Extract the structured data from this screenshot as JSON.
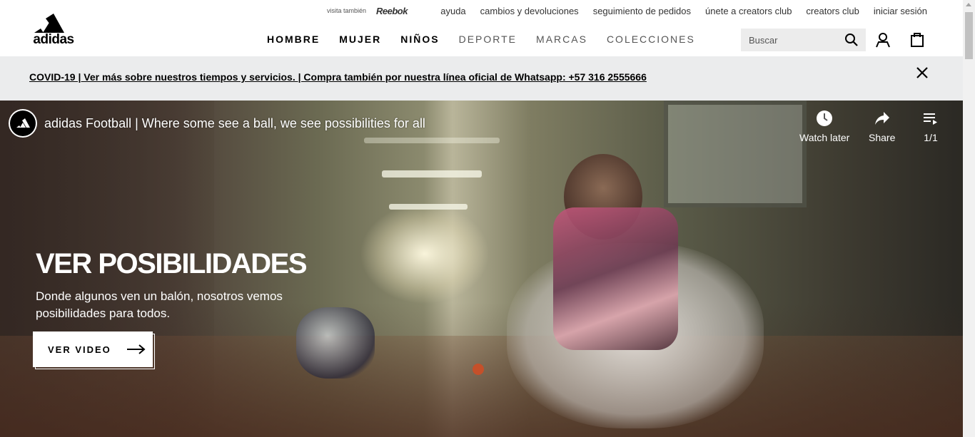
{
  "utility": {
    "visit_label": "visita también",
    "reebok_label": "Reebok",
    "links": [
      "ayuda",
      "cambios y devoluciones",
      "seguimiento de pedidos",
      "únete a creators club",
      "creators club",
      "iniciar sesión"
    ]
  },
  "logo": {
    "text": "adidas"
  },
  "nav": {
    "items": [
      {
        "label": "HOMBRE",
        "weight": "bold"
      },
      {
        "label": "MUJER",
        "weight": "bold"
      },
      {
        "label": "NIÑOS",
        "weight": "bold"
      },
      {
        "label": "DEPORTE",
        "weight": "light"
      },
      {
        "label": "MARCAS",
        "weight": "light"
      },
      {
        "label": "COLECCIONES",
        "weight": "light"
      }
    ]
  },
  "search": {
    "placeholder": "Buscar",
    "value": ""
  },
  "icons": {
    "search": "search-icon",
    "account": "account-icon",
    "bag": "shopping-bag-icon",
    "close": "close-icon",
    "clock": "clock-icon",
    "share": "share-icon",
    "playlist": "playlist-icon",
    "arrow": "arrow-right-icon"
  },
  "banner": {
    "text": "COVID-19 | Ver más sobre nuestros tiempos y servicios. | Compra también por nuestra línea oficial de Whatsapp: +57 316 2555666"
  },
  "video": {
    "title": "adidas Football | Where some see a ball, we see possibilities for all",
    "watch_later": "Watch later",
    "share": "Share",
    "playlist_count": "1/1"
  },
  "hero": {
    "heading": "VER POSIBILIDADES",
    "subheading": "Donde algunos ven un balón, nosotros vemos posibilidades para todos.",
    "cta": "VER VIDEO"
  },
  "colors": {
    "banner_bg": "#ebeced",
    "search_bg": "#ececec",
    "text": "#000000",
    "hero_text": "#ffffff"
  }
}
